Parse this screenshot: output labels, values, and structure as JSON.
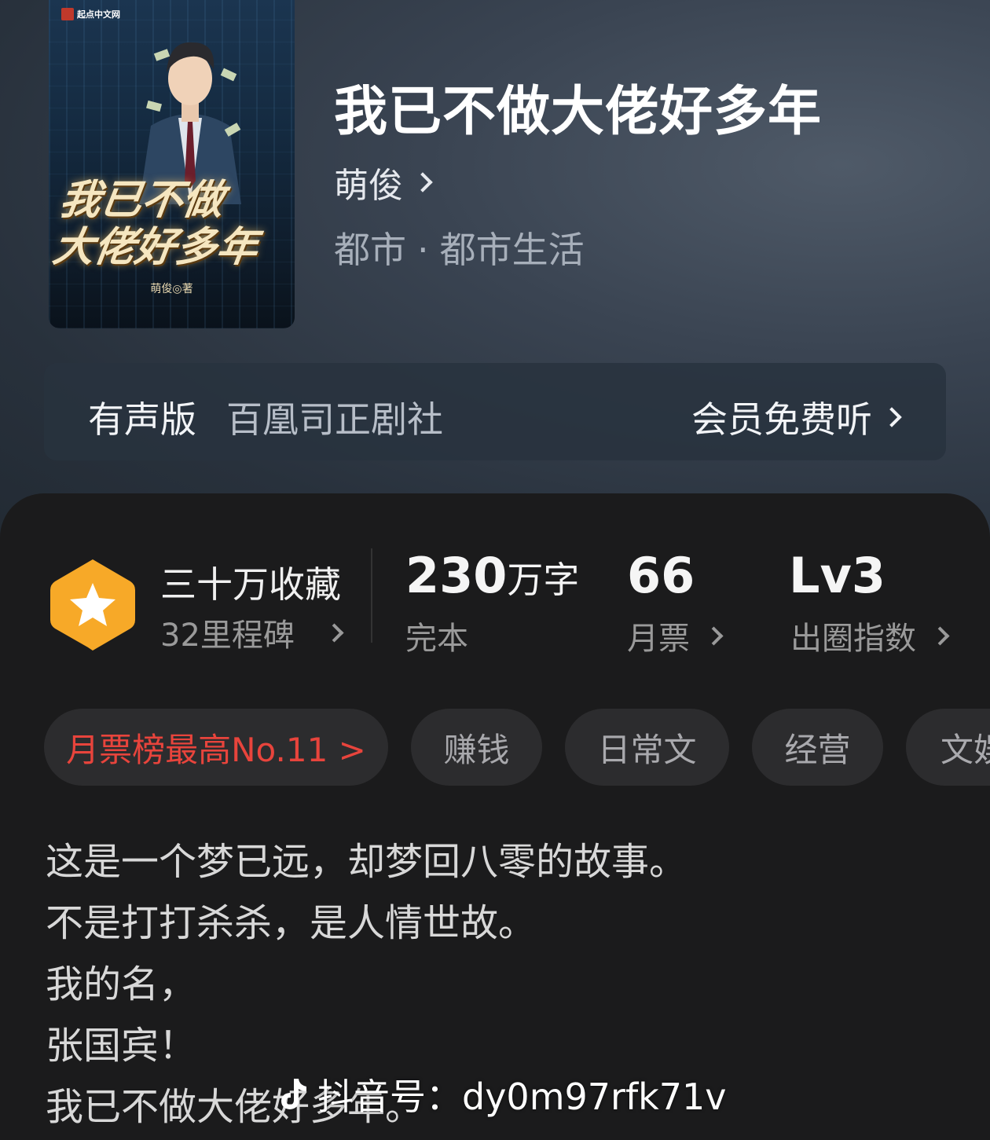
{
  "book": {
    "title": "我已不做大佬好多年",
    "author": "萌俊",
    "category": "都市",
    "category_dot": "·",
    "subcategory": "都市生活"
  },
  "cover": {
    "publisher": "起点中文网",
    "title_line1": "我已不做",
    "title_line2": "大佬好多年",
    "author_line": "萌俊◎著"
  },
  "audio": {
    "label": "有声版",
    "studio": "百凰司正剧社",
    "action": "会员免费听"
  },
  "stats": {
    "favorites_title": "三十万收藏",
    "milestones": "32里程碑",
    "word_count_value": "230",
    "word_count_unit": "万字",
    "status": "完本",
    "monthly_votes_value": "66",
    "monthly_votes_label": "月票",
    "level_value": "Lv3",
    "level_label": "出圈指数"
  },
  "tags": [
    "月票榜最高No.11 >",
    "赚钱",
    "日常文",
    "经营",
    "文娱"
  ],
  "synopsis": [
    "这是一个梦已远，却梦回八零的故事。",
    "不是打打杀杀，是人情世故。",
    "我的名，",
    "张国宾！",
    "我已不做大佬好多年。"
  ],
  "watermark": {
    "text": "抖音号：dy0m97rfk71v",
    "icon": "douyin-logo-icon"
  },
  "colors": {
    "accent_red": "#e8443c",
    "badge_orange": "#f7a928"
  }
}
